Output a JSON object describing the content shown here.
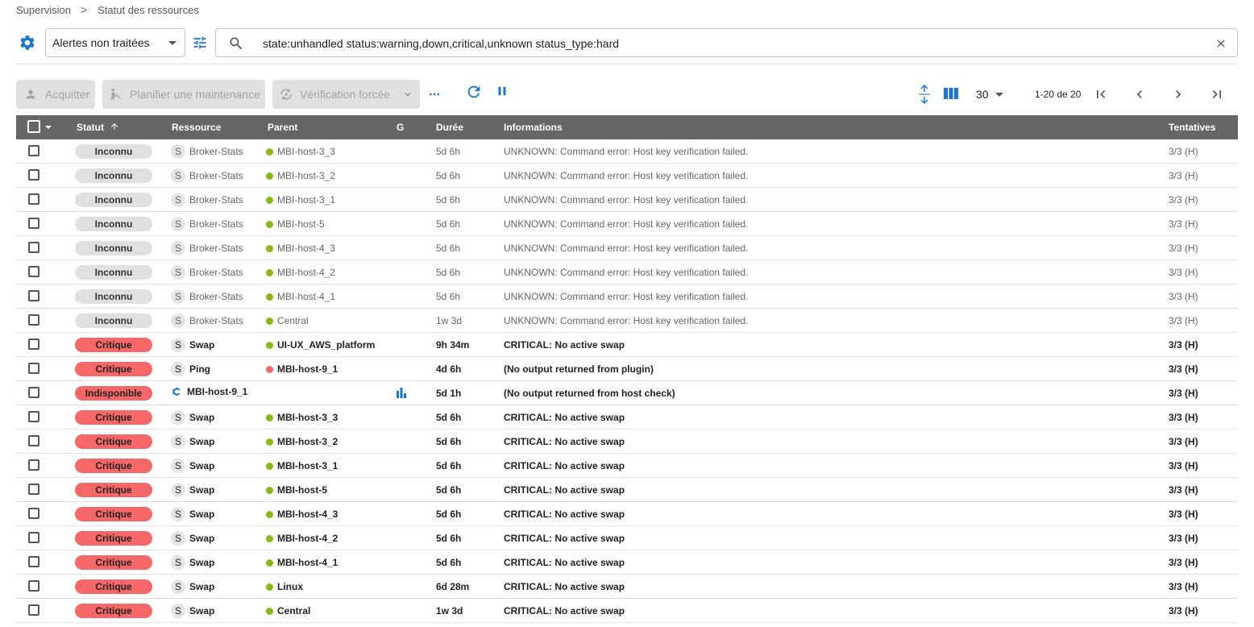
{
  "breadcrumb": {
    "root": "Supervision",
    "separator": ">",
    "current": "Statut des ressources"
  },
  "filter": {
    "selected": "Alertes non traitées",
    "search_value": "state:unhandled status:warning,down,critical,unknown status_type:hard"
  },
  "actions": {
    "acknowledge": "Acquitter",
    "downtime": "Planifier une maintenance",
    "check": "Vérification forcée"
  },
  "pagination": {
    "per_page": "30",
    "range": "1-20 de 20"
  },
  "colors": {
    "accent": "#1976d2",
    "header_bg": "#666666",
    "critical": "#f66767",
    "unknown": "#e0e0e0",
    "ok_dot": "#88b917",
    "down_dot": "#f66767"
  },
  "columns": {
    "status": "Statut",
    "resource": "Ressource",
    "parent": "Parent",
    "graph": "G",
    "duration": "Durée",
    "information": "Informations",
    "tries": "Tentatives"
  },
  "rows": [
    {
      "status": "Inconnu",
      "type_letter": "S",
      "resource": "Broker-Stats",
      "parent": "MBI-host-3_3",
      "duration": "5d 6h",
      "info": "UNKNOWN: Command error: Host key verification failed.",
      "tries": "3/3 (H)"
    },
    {
      "status": "Inconnu",
      "type_letter": "S",
      "resource": "Broker-Stats",
      "parent": "MBI-host-3_2",
      "duration": "5d 6h",
      "info": "UNKNOWN: Command error: Host key verification failed.",
      "tries": "3/3 (H)"
    },
    {
      "status": "Inconnu",
      "type_letter": "S",
      "resource": "Broker-Stats",
      "parent": "MBI-host-3_1",
      "duration": "5d 6h",
      "info": "UNKNOWN: Command error: Host key verification failed.",
      "tries": "3/3 (H)"
    },
    {
      "status": "Inconnu",
      "type_letter": "S",
      "resource": "Broker-Stats",
      "parent": "MBI-host-5",
      "duration": "5d 6h",
      "info": "UNKNOWN: Command error: Host key verification failed.",
      "tries": "3/3 (H)"
    },
    {
      "status": "Inconnu",
      "type_letter": "S",
      "resource": "Broker-Stats",
      "parent": "MBI-host-4_3",
      "duration": "5d 6h",
      "info": "UNKNOWN: Command error: Host key verification failed.",
      "tries": "3/3 (H)"
    },
    {
      "status": "Inconnu",
      "type_letter": "S",
      "resource": "Broker-Stats",
      "parent": "MBI-host-4_2",
      "duration": "5d 6h",
      "info": "UNKNOWN: Command error: Host key verification failed.",
      "tries": "3/3 (H)"
    },
    {
      "status": "Inconnu",
      "type_letter": "S",
      "resource": "Broker-Stats",
      "parent": "MBI-host-4_1",
      "duration": "5d 6h",
      "info": "UNKNOWN: Command error: Host key verification failed.",
      "tries": "3/3 (H)"
    },
    {
      "status": "Inconnu",
      "type_letter": "S",
      "resource": "Broker-Stats",
      "parent": "Central",
      "duration": "1w 3d",
      "info": "UNKNOWN: Command error: Host key verification failed.",
      "tries": "3/3 (H)"
    },
    {
      "status": "Critique",
      "type_letter": "S",
      "resource": "Swap",
      "parent": "UI-UX_AWS_platform",
      "duration": "9h 34m",
      "info": "CRITICAL: No active swap",
      "tries": "3/3 (H)"
    },
    {
      "status": "Critique",
      "type_letter": "S",
      "resource": "Ping",
      "parent": "MBI-host-9_1",
      "duration": "4d 6h",
      "info": "(No output returned from plugin)",
      "tries": "3/3 (H)"
    },
    {
      "status": "Indisponible",
      "type_letter": "",
      "resource": "MBI-host-9_1",
      "parent": "",
      "duration": "5d 1h",
      "info": "(No output returned from host check)",
      "tries": "3/3 (H)"
    },
    {
      "status": "Critique",
      "type_letter": "S",
      "resource": "Swap",
      "parent": "MBI-host-3_3",
      "duration": "5d 6h",
      "info": "CRITICAL: No active swap",
      "tries": "3/3 (H)"
    },
    {
      "status": "Critique",
      "type_letter": "S",
      "resource": "Swap",
      "parent": "MBI-host-3_2",
      "duration": "5d 6h",
      "info": "CRITICAL: No active swap",
      "tries": "3/3 (H)"
    },
    {
      "status": "Critique",
      "type_letter": "S",
      "resource": "Swap",
      "parent": "MBI-host-3_1",
      "duration": "5d 6h",
      "info": "CRITICAL: No active swap",
      "tries": "3/3 (H)"
    },
    {
      "status": "Critique",
      "type_letter": "S",
      "resource": "Swap",
      "parent": "MBI-host-5",
      "duration": "5d 6h",
      "info": "CRITICAL: No active swap",
      "tries": "3/3 (H)"
    },
    {
      "status": "Critique",
      "type_letter": "S",
      "resource": "Swap",
      "parent": "MBI-host-4_3",
      "duration": "5d 6h",
      "info": "CRITICAL: No active swap",
      "tries": "3/3 (H)"
    },
    {
      "status": "Critique",
      "type_letter": "S",
      "resource": "Swap",
      "parent": "MBI-host-4_2",
      "duration": "5d 6h",
      "info": "CRITICAL: No active swap",
      "tries": "3/3 (H)"
    },
    {
      "status": "Critique",
      "type_letter": "S",
      "resource": "Swap",
      "parent": "MBI-host-4_1",
      "duration": "5d 6h",
      "info": "CRITICAL: No active swap",
      "tries": "3/3 (H)"
    },
    {
      "status": "Critique",
      "type_letter": "S",
      "resource": "Swap",
      "parent": "Linux",
      "duration": "6d 28m",
      "info": "CRITICAL: No active swap",
      "tries": "3/3 (H)"
    },
    {
      "status": "Critique",
      "type_letter": "S",
      "resource": "Swap",
      "parent": "Central",
      "duration": "1w 3d",
      "info": "CRITICAL: No active swap",
      "tries": "3/3 (H)"
    }
  ]
}
